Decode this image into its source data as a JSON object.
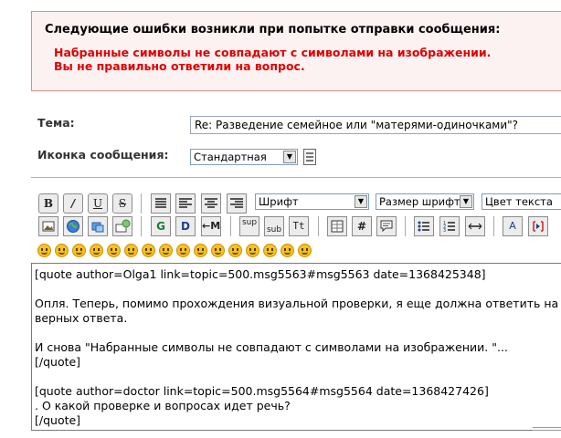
{
  "errors": {
    "title": "Следующие ошибки возникли при попытке отправки сообщения:",
    "lines": [
      "Набранные символы не совпадают с символами на изображении.",
      "Вы не правильно ответили на вопрос."
    ]
  },
  "form": {
    "subject_label": "Тема:",
    "subject_value": "Re: Разведение семейное или \"матерями-одиночками\"?",
    "icon_label": "Иконка сообщения:",
    "icon_value": "Стандартная"
  },
  "toolbar": {
    "font_select": "Шрифт",
    "size_select": "Размер шрифта",
    "color_select": "Цвет текста",
    "row1_buttons": [
      {
        "name": "bold",
        "glyph": "B"
      },
      {
        "name": "italic",
        "glyph": "/"
      },
      {
        "name": "underline",
        "glyph": "U"
      },
      {
        "name": "strikethrough",
        "glyph": "S"
      },
      {
        "name": "pre",
        "glyph": ""
      },
      {
        "name": "align-left",
        "glyph": ""
      },
      {
        "name": "align-center",
        "glyph": ""
      },
      {
        "name": "align-right",
        "glyph": ""
      }
    ],
    "row2_buttons": [
      {
        "name": "image",
        "glyph": ""
      },
      {
        "name": "hyperlink",
        "glyph": ""
      },
      {
        "name": "ftp-link",
        "glyph": ""
      },
      {
        "name": "email",
        "glyph": ""
      },
      {
        "name": "glow",
        "glyph": "G"
      },
      {
        "name": "shadow",
        "glyph": "D"
      },
      {
        "name": "move",
        "glyph": "M"
      },
      {
        "name": "superscript",
        "glyph": "sup"
      },
      {
        "name": "subscript",
        "glyph": "sub"
      },
      {
        "name": "teletype",
        "glyph": "Tt"
      },
      {
        "name": "table",
        "glyph": ""
      },
      {
        "name": "code",
        "glyph": "#"
      },
      {
        "name": "quote",
        "glyph": ""
      },
      {
        "name": "bullet-list",
        "glyph": ""
      },
      {
        "name": "numbered-list",
        "glyph": ""
      },
      {
        "name": "horizontal-rule",
        "glyph": ""
      },
      {
        "name": "spell-check",
        "glyph": "A"
      },
      {
        "name": "toggle-view",
        "glyph": ""
      }
    ],
    "smileys": [
      "smiley",
      "wink",
      "cheesy",
      "grin",
      "angry",
      "sad",
      "shocked",
      "cool",
      "huh",
      "rolleyes",
      "tongue",
      "embarrassed",
      "lipsrsealed",
      "undecided",
      "kiss",
      "cry"
    ]
  },
  "message": {
    "lines": [
      "[quote author=Olga1 link=topic=500.msg5563#msg5563 date=1368425348]",
      "",
      "Опля. Теперь, помимо прохождения визуальной проверки, я еще должна ответить на т",
      "верных ответа.",
      "",
      "И снова \"Набранные символы не совпадают с символами на изображении. \"...",
      "[/quote]",
      "",
      "[quote author=doctor link=topic=500.msg5564#msg5564 date=1368427426]",
      ". О какой  проверке и  вопросах идет речь?",
      "[/quote]"
    ]
  }
}
